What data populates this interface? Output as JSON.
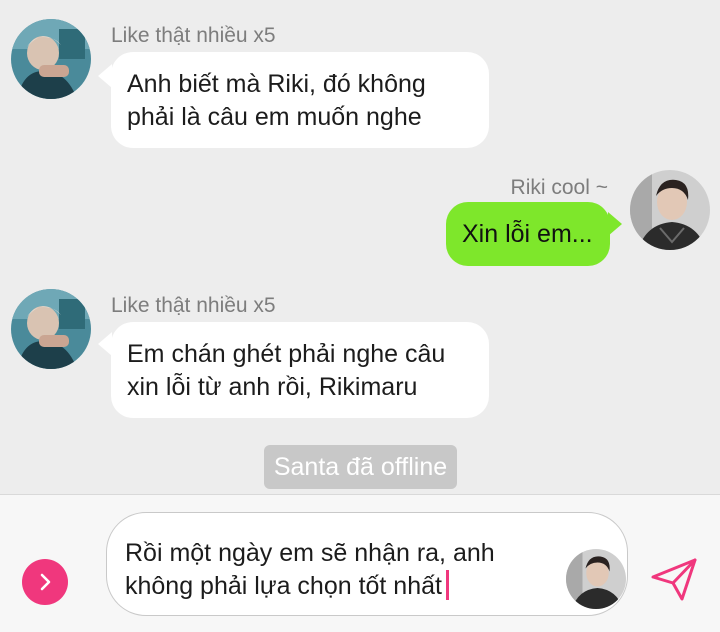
{
  "messages": [
    {
      "direction": "in",
      "sender": "Like thật nhiều x5",
      "lines": [
        "Anh biết mà Riki, đó không",
        "phải là câu em muốn nghe"
      ]
    },
    {
      "direction": "out",
      "sender": "Riki cool ~",
      "lines": [
        "Xin lỗi em..."
      ]
    },
    {
      "direction": "in",
      "sender": "Like thật nhiều x5",
      "lines": [
        "Em chán ghét phải nghe câu",
        "xin lỗi từ anh rồi, Rikimaru"
      ]
    }
  ],
  "system_notice": "Santa đã offline",
  "composer": {
    "text_lines": [
      "Rồi một ngày em sẽ nhận ra, anh",
      "không phải lựa chọn tốt nhất"
    ]
  },
  "icons": {
    "expand": "chevron-right-icon",
    "send": "paper-plane-icon"
  },
  "colors": {
    "outgoing_bubble": "#7ee72b",
    "incoming_bubble": "#ffffff",
    "accent": "#f0377d",
    "system_badge": "#c8c8c8"
  }
}
